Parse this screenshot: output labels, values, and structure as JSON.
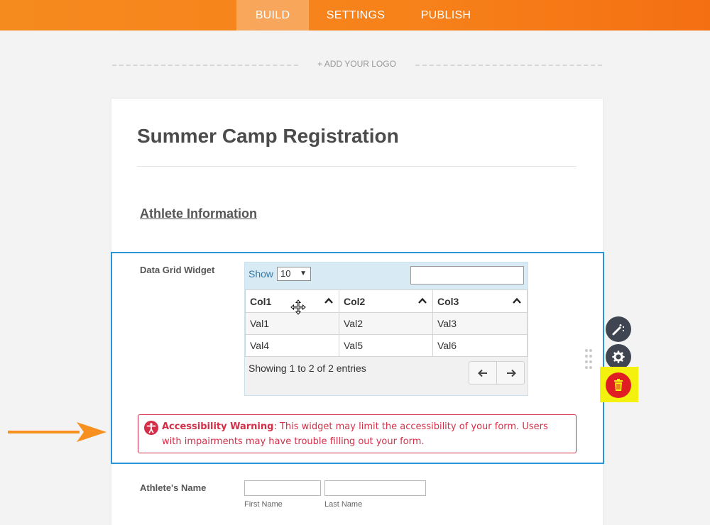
{
  "nav": {
    "tabs": [
      {
        "label": "BUILD",
        "active": true
      },
      {
        "label": "SETTINGS",
        "active": false
      },
      {
        "label": "PUBLISH",
        "active": false
      }
    ]
  },
  "logo": {
    "add_label": "+ ADD YOUR LOGO"
  },
  "form": {
    "title": "Summer Camp Registration",
    "section_title": "Athlete Information"
  },
  "widget": {
    "label": "Data Grid Widget",
    "show_label": "Show",
    "show_value": "10",
    "search_value": "",
    "columns": [
      "Col1",
      "Col2",
      "Col3"
    ],
    "rows": [
      [
        "Val1",
        "Val2",
        "Val3"
      ],
      [
        "Val4",
        "Val5",
        "Val6"
      ]
    ],
    "info": "Showing 1 to 2 of 2 entries",
    "prev_icon": "arrow-left-icon",
    "next_icon": "arrow-right-icon"
  },
  "warning": {
    "title": "Accessibility Warning",
    "text": ": This widget may limit the accessibility of your form. Users with impairments may have trouble filling out your form."
  },
  "athlete_name": {
    "label": "Athlete's Name",
    "first_label": "First Name",
    "last_label": "Last Name",
    "first_value": "",
    "last_value": ""
  },
  "tools": [
    "magic-wand-icon",
    "gear-icon",
    "trash-icon"
  ],
  "colors": {
    "nav_orange": "#f7811a",
    "selection_blue": "#2b94d6",
    "warning_red": "#d32f48",
    "delete_red": "#e11d24",
    "highlight_yellow": "#f4f10f",
    "annotation_arrow": "#f7901e"
  }
}
